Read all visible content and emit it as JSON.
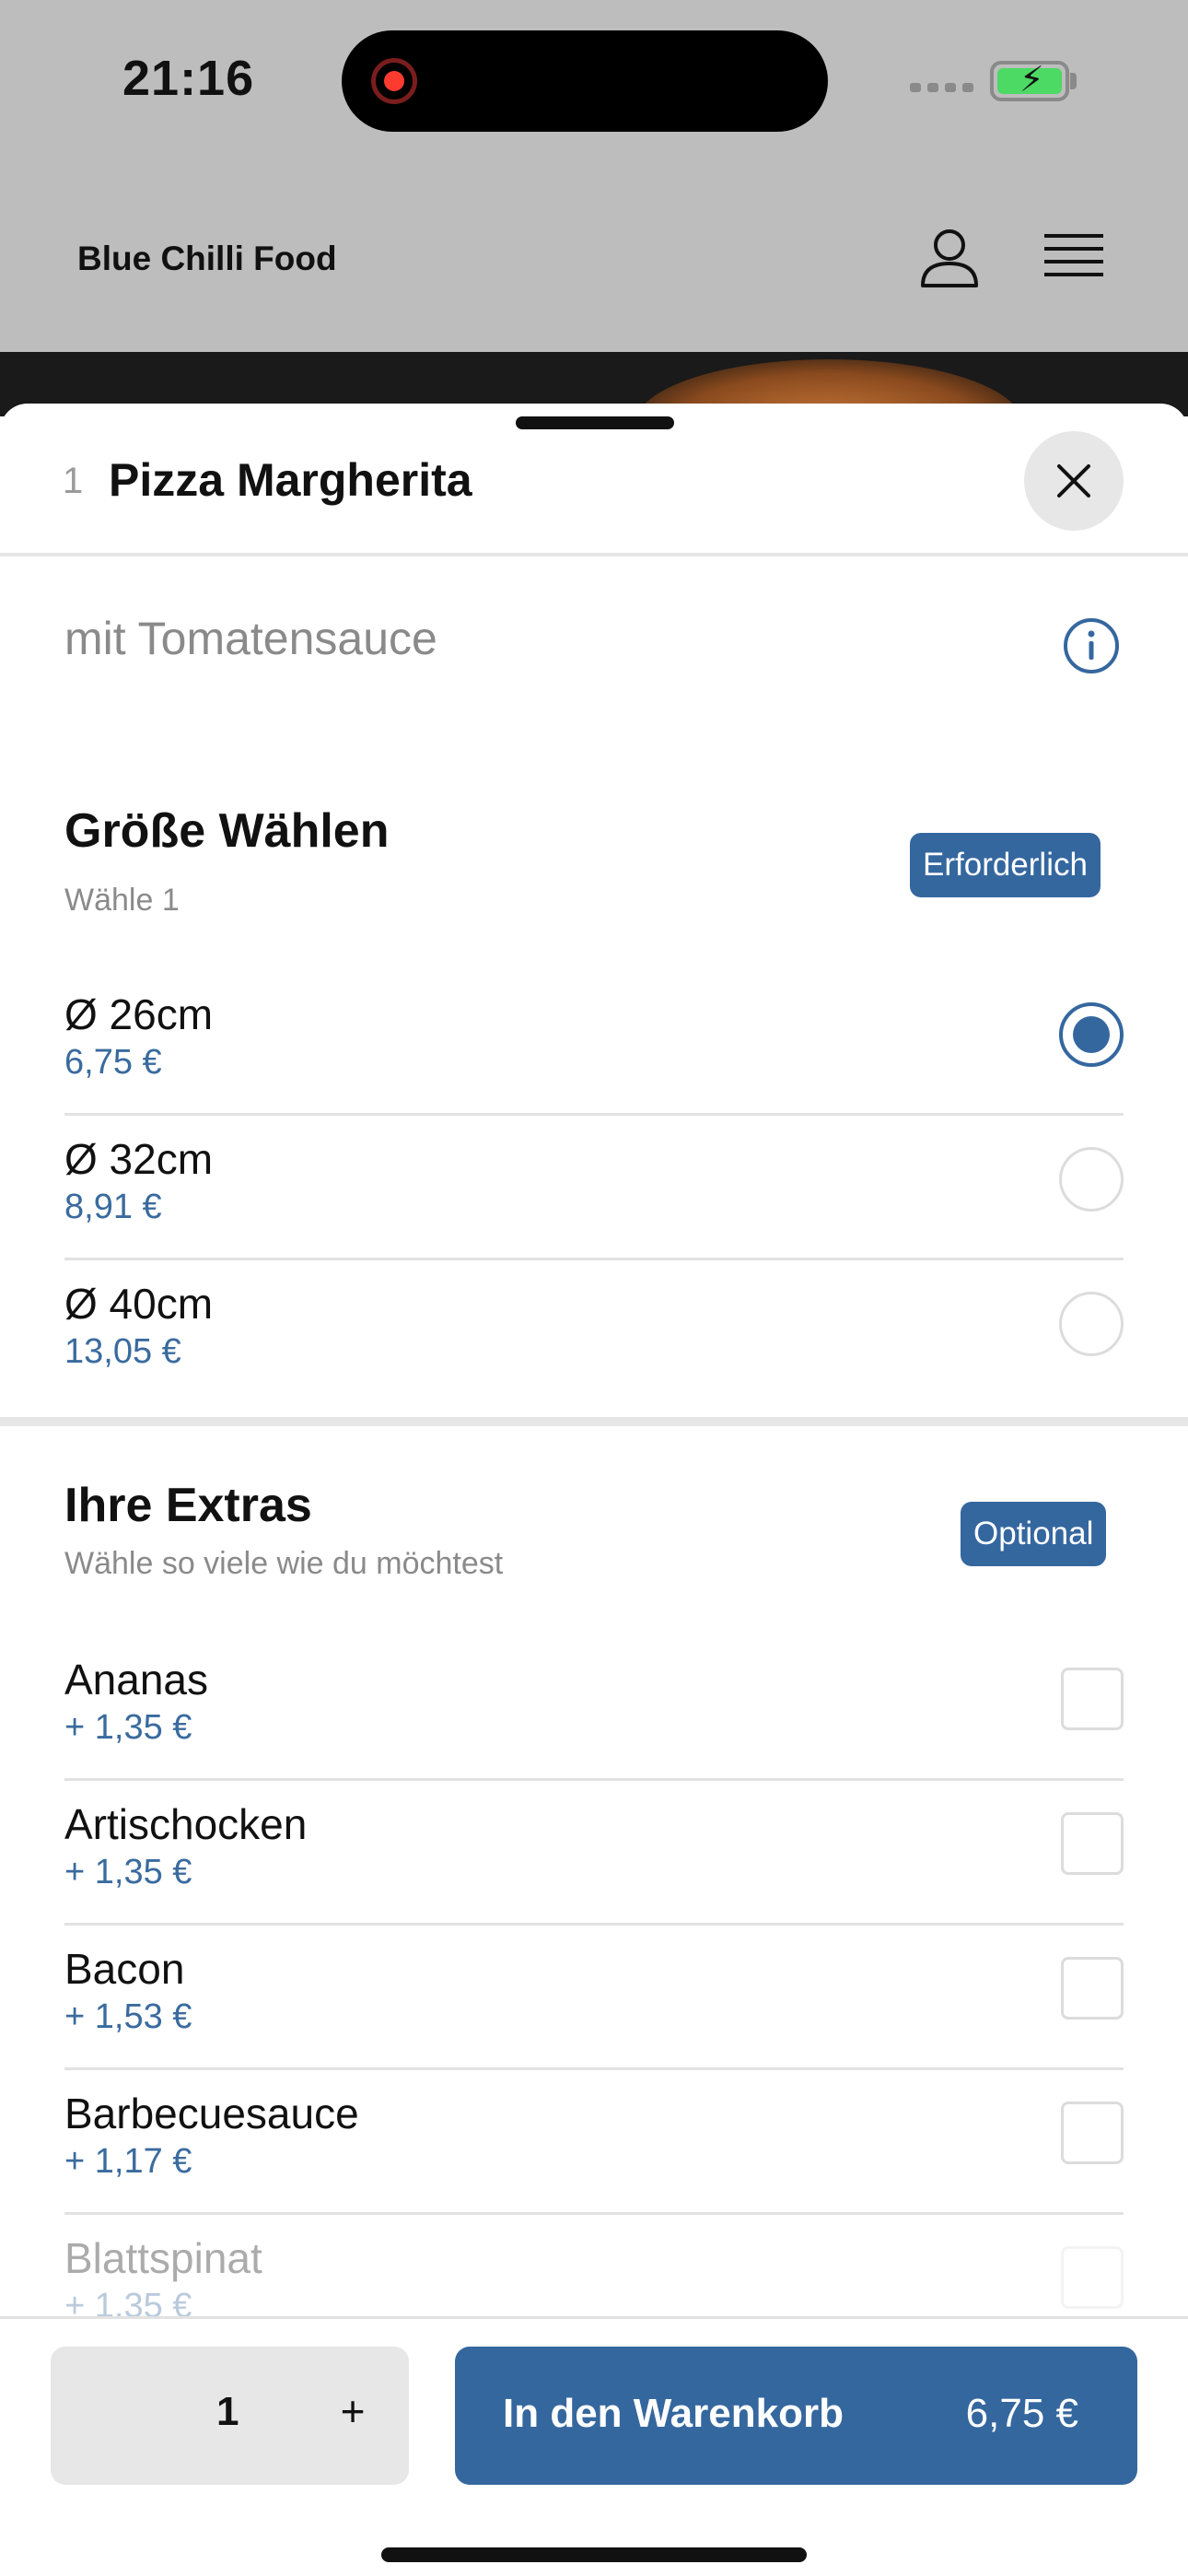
{
  "status_bar": {
    "time": "21:16"
  },
  "app": {
    "title": "Blue Chilli Food"
  },
  "item": {
    "number": "1",
    "title": "Pizza Margherita",
    "description": "mit Tomatensauce"
  },
  "size_section": {
    "title": "Größe Wählen",
    "subtitle": "Wähle 1",
    "badge": "Erforderlich",
    "options": [
      {
        "name": "Ø 26cm",
        "price": "6,75 €",
        "selected": true
      },
      {
        "name": "Ø 32cm",
        "price": "8,91 €",
        "selected": false
      },
      {
        "name": "Ø 40cm",
        "price": "13,05 €",
        "selected": false
      }
    ]
  },
  "extras_section": {
    "title": "Ihre Extras",
    "subtitle": "Wähle so viele wie du möchtest",
    "badge": "Optional",
    "options": [
      {
        "name": "Ananas",
        "price": "+ 1,35 €"
      },
      {
        "name": "Artischocken",
        "price": "+ 1,35 €"
      },
      {
        "name": "Bacon",
        "price": "+ 1,53 €"
      },
      {
        "name": "Barbecuesauce",
        "price": "+ 1,17 €"
      },
      {
        "name": "Blattspinat",
        "price": "+ 1,35 €"
      }
    ]
  },
  "bottom_bar": {
    "quantity": "1",
    "plus": "+",
    "cart_label": "In den Warenkorb",
    "cart_price": "6,75 €"
  },
  "colors": {
    "accent": "#35679f",
    "price_text": "#3a6b9e",
    "overlay": "#bdbdbd"
  }
}
